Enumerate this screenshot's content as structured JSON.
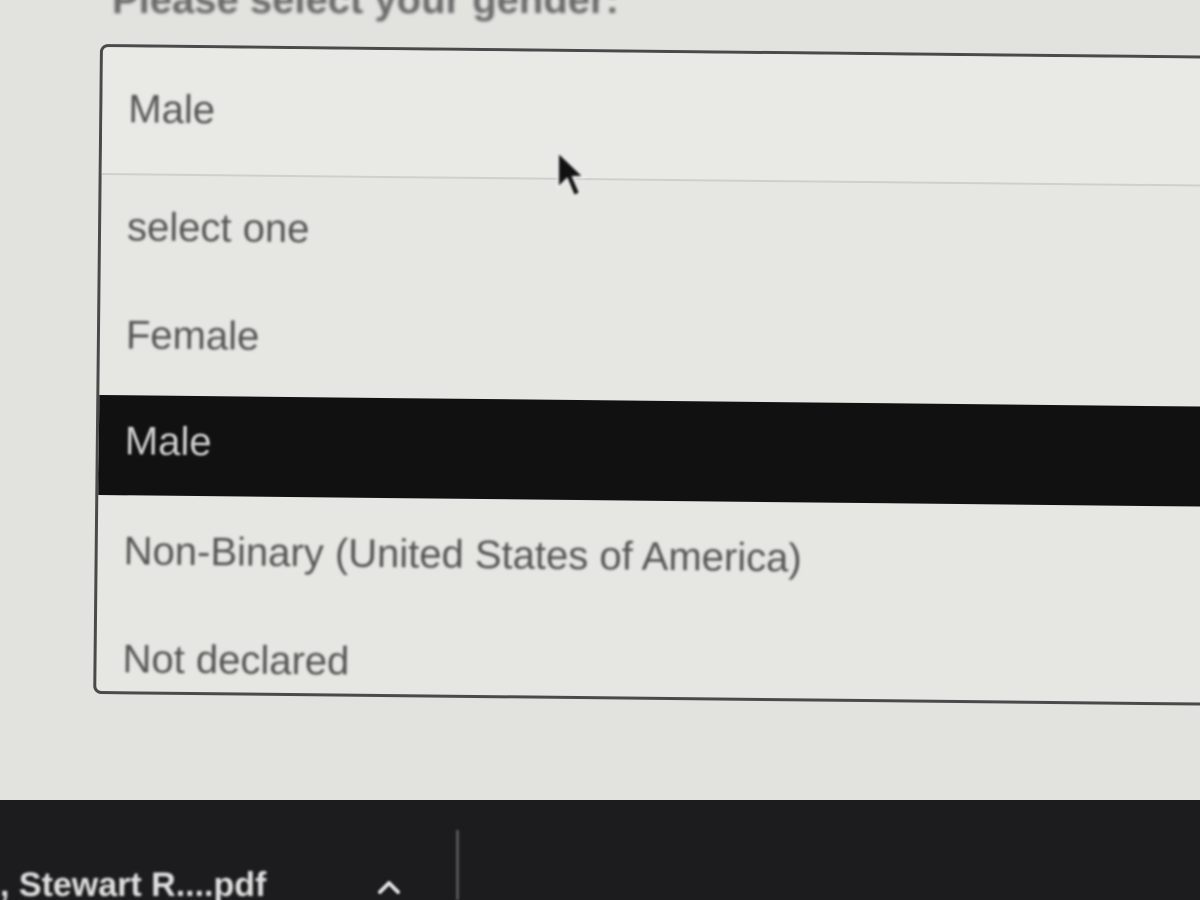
{
  "form": {
    "question_label": "Please select your gender:",
    "select": {
      "current_value": "Male",
      "options": [
        {
          "label": "select one"
        },
        {
          "label": "Female"
        },
        {
          "label": "Male",
          "selected": true
        },
        {
          "label": "Non-Binary (United States of America)"
        },
        {
          "label": "Not declared"
        }
      ]
    }
  },
  "taskbar": {
    "download_file_name": ", Stewart R....pdf"
  },
  "icons": {
    "dropdown_arrow": "chevron-down-icon",
    "cursor": "mouse-pointer-icon",
    "download_expand": "chevron-up-icon"
  },
  "colors": {
    "selected_option_bg": "#111111",
    "selected_option_text": "#cfcfcf",
    "option_text": "#555555",
    "taskbar_bg": "#1c1c1e"
  }
}
